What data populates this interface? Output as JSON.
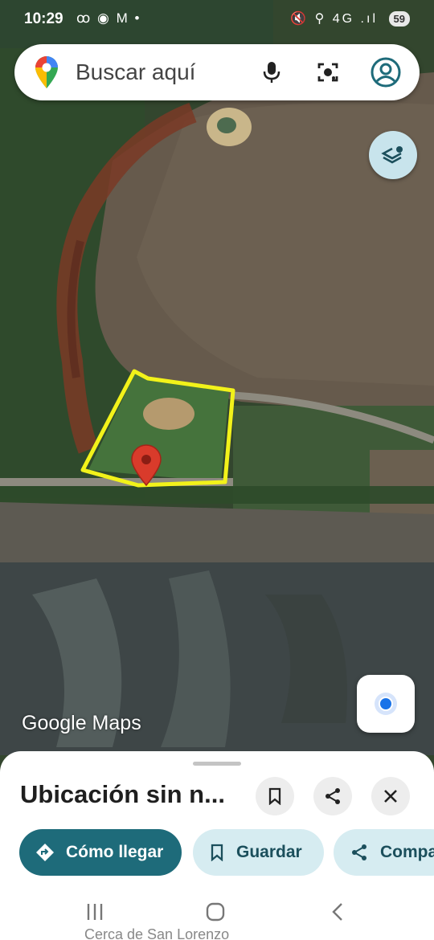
{
  "status_bar": {
    "time": "10:29",
    "left_icons": "ꝏ ◉ M •",
    "right_icons": "🔇 ⚲ 4G .ıl",
    "battery": "59"
  },
  "search": {
    "placeholder": "Buscar aquí",
    "logo_icon": "google-maps-pin-icon",
    "mic_icon": "microphone-icon",
    "lens_icon": "camera-lens-icon",
    "account_icon": "account-icon"
  },
  "map": {
    "watermark": "Google Maps",
    "layers_icon": "layers-icon",
    "location_icon": "my-location-icon"
  },
  "place_sheet": {
    "title": "Ubicación sin n...",
    "save_icon": "bookmark-icon",
    "share_icon": "share-icon",
    "close_icon": "close-icon",
    "actions": [
      {
        "label": "Cómo llegar",
        "icon": "directions-icon"
      },
      {
        "label": "Guardar",
        "icon": "bookmark-icon"
      },
      {
        "label": "Compa",
        "icon": "share-icon"
      }
    ],
    "peek_text": "Cerca de San Lorenzo"
  },
  "colors": {
    "accent": "#1e6b7a",
    "secondary_pill": "#d6ecf1",
    "polygon": "#f2f21a",
    "marker": "#d93b2b"
  }
}
